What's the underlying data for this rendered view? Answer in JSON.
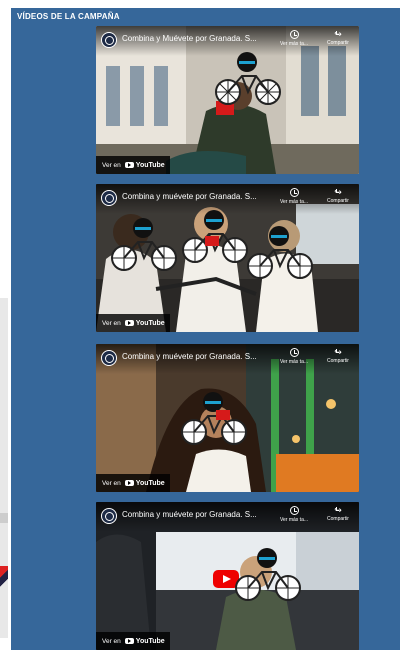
{
  "panel": {
    "title": "VÍDEOS DE LA CAMPAÑA"
  },
  "videos": [
    {
      "title": "Combina y Muévete por Granada. S...",
      "watch_later": "Ver más ta...",
      "share": "Compartir",
      "watch_on": "Ver en",
      "platform": "YouTube"
    },
    {
      "title": "Combina y muévete por Granada. S...",
      "watch_later": "Ver más ta...",
      "share": "Compartir",
      "watch_on": "Ver en",
      "platform": "YouTube"
    },
    {
      "title": "Combina y muévete por Granada. S...",
      "watch_later": "Ver más ta...",
      "share": "Compartir",
      "watch_on": "Ver en",
      "platform": "YouTube"
    },
    {
      "title": "Combina y muévete por Granada. S...",
      "watch_later": "Ver más ta...",
      "share": "Compartir",
      "watch_on": "Ver en",
      "platform": "YouTube"
    }
  ],
  "colors": {
    "panel": "#36679a",
    "youtube_red": "#ee0000"
  },
  "icons": [
    "channel-logo-icon",
    "clock-icon",
    "share-icon",
    "youtube-logo-icon",
    "bike-emoji-icon",
    "play-icon"
  ]
}
